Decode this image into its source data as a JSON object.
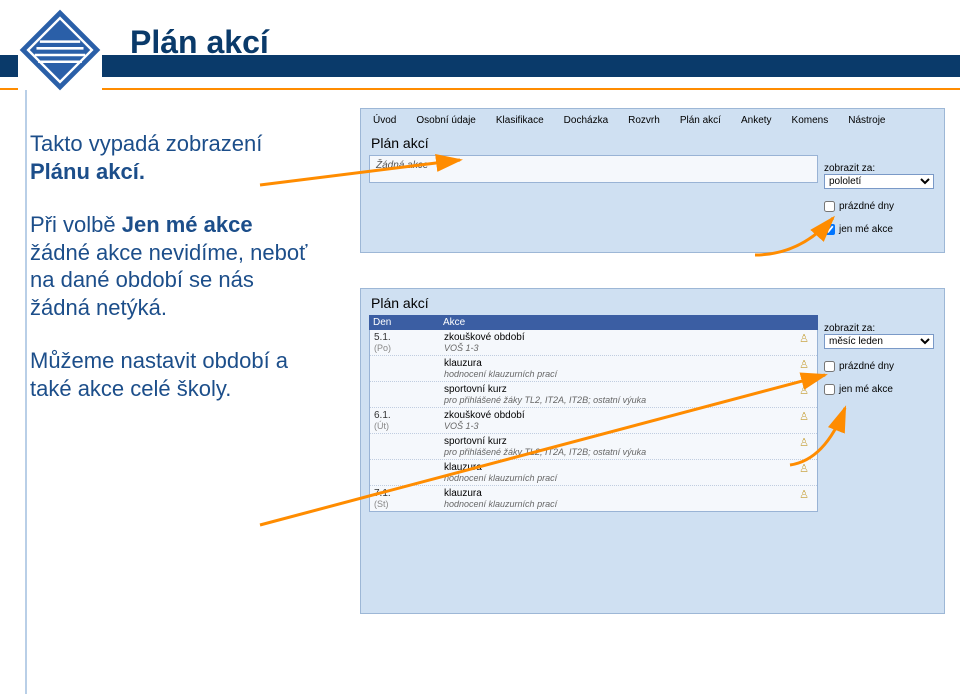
{
  "title": "Plán akcí",
  "left": {
    "p1a": "Takto vypadá zobrazení ",
    "p1b": "Plánu akcí.",
    "p2a": "Při volbě ",
    "p2b": "Jen mé akce",
    "p2c": " žádné akce nevidíme, neboť na dané období se nás žádná netýká.",
    "p3": "Můžeme nastavit období a také akce celé školy."
  },
  "tabs": [
    "Úvod",
    "Osobní údaje",
    "Klasifikace",
    "Docházka",
    "Rozvrh",
    "Plán akcí",
    "Ankety",
    "Komens",
    "Nástroje"
  ],
  "panel1": {
    "heading": "Plán akcí",
    "empty": "Žádná akce",
    "sideLabel": "zobrazit za:",
    "selectValue": "pololetí",
    "chk1": "prázdné dny",
    "chk2": "jen mé akce"
  },
  "panel2": {
    "heading": "Plán akcí",
    "col1": "Den",
    "col2": "Akce",
    "sideLabel": "zobrazit za:",
    "selectValue": "měsíc leden",
    "chk1": "prázdné dny",
    "chk2": "jen mé akce",
    "rows": [
      {
        "date": "5.1.",
        "dow": "(Po)",
        "title": "zkouškové období",
        "sub": "VOŠ 1-3"
      },
      {
        "date": "",
        "dow": "",
        "title": "klauzura",
        "sub": "hodnocení klauzurních prací"
      },
      {
        "date": "",
        "dow": "",
        "title": "sportovní kurz",
        "sub": "pro přihlášené žáky TL2, IT2A, IT2B; ostatní výuka"
      },
      {
        "date": "6.1.",
        "dow": "(Út)",
        "title": "zkouškové období",
        "sub": "VOŠ 1-3"
      },
      {
        "date": "",
        "dow": "",
        "title": "sportovní kurz",
        "sub": "pro přihlášené žáky TL2, IT2A, IT2B; ostatní výuka"
      },
      {
        "date": "",
        "dow": "",
        "title": "klauzura",
        "sub": "hodnocení klauzurních prací"
      },
      {
        "date": "7.1.",
        "dow": "(St)",
        "title": "klauzura",
        "sub": "hodnocení klauzurních prací"
      }
    ]
  }
}
